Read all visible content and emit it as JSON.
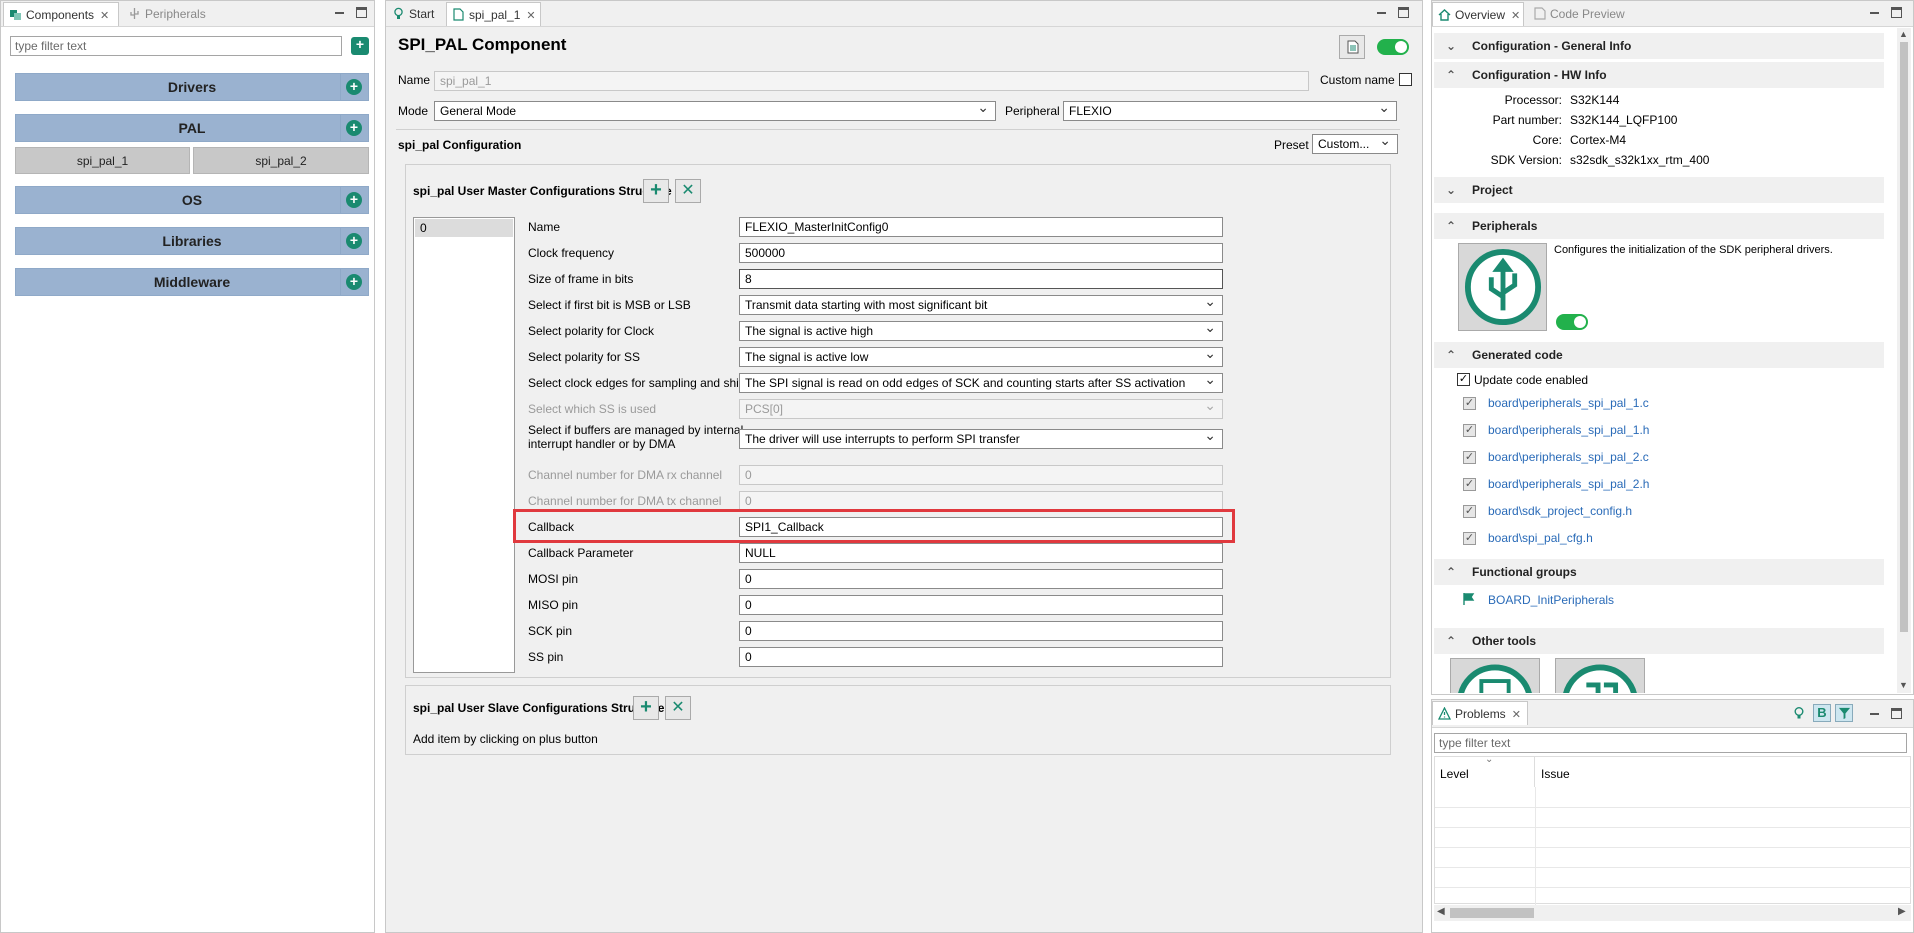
{
  "left_panel": {
    "tabs": [
      {
        "label": "Components"
      },
      {
        "label": "Peripherals"
      }
    ],
    "filter_placeholder": "type filter text",
    "categories": {
      "drivers": "Drivers",
      "pal": "PAL",
      "os": "OS",
      "libraries": "Libraries",
      "middleware": "Middleware"
    },
    "pal_items": [
      "spi_pal_1",
      "spi_pal_2"
    ]
  },
  "center_panel": {
    "tabs": [
      {
        "label": "Start"
      },
      {
        "label": "spi_pal_1"
      }
    ],
    "title": "SPI_PAL Component",
    "name_label": "Name",
    "name_value": "spi_pal_1",
    "custom_name_label": "Custom name",
    "mode_label": "Mode",
    "mode_value": "General Mode",
    "peripheral_label": "Peripheral",
    "peripheral_value": "FLEXIO",
    "config_section": "spi_pal Configuration",
    "preset_label": "Preset",
    "preset_value": "Custom...",
    "master_struct": {
      "title": "spi_pal User Master Configurations Structure",
      "list_items": [
        "0"
      ],
      "rows": [
        {
          "label": "Name",
          "value": "FLEXIO_MasterInitConfig0"
        },
        {
          "label": "Clock frequency",
          "value": "500000"
        },
        {
          "label": "Size of frame in bits",
          "value": "8"
        },
        {
          "label": "Select if first bit is MSB or LSB",
          "value": "Transmit data starting with most significant bit"
        },
        {
          "label": "Select polarity for Clock",
          "value": "The signal is active high"
        },
        {
          "label": "Select polarity for SS",
          "value": "The signal is active low"
        },
        {
          "label": "Select clock edges for sampling and shifting",
          "value": "The SPI signal is read on odd edges of SCK and counting starts after SS activation"
        },
        {
          "label": "Select which SS is used",
          "value": "PCS[0]"
        },
        {
          "label": "Select if buffers are managed by internal",
          "label2": "interrupt handler or by DMA",
          "value": "The driver will use interrupts to perform SPI transfer"
        },
        {
          "label": "Channel number for DMA rx channel",
          "value": "0"
        },
        {
          "label": "Channel number for DMA tx channel",
          "value": "0"
        },
        {
          "label": "Callback",
          "value": "SPI1_Callback"
        },
        {
          "label": "Callback Parameter",
          "value": "NULL"
        },
        {
          "label": "MOSI pin",
          "value": "0"
        },
        {
          "label": "MISO pin",
          "value": "0"
        },
        {
          "label": "SCK pin",
          "value": "0"
        },
        {
          "label": "SS pin",
          "value": "0"
        }
      ]
    },
    "slave_struct": {
      "title": "spi_pal User Slave Configurations Structure",
      "hint": "Add item by clicking on plus button"
    }
  },
  "right_panel": {
    "tabs": [
      {
        "label": "Overview"
      },
      {
        "label": "Code Preview"
      }
    ],
    "sections": {
      "general_info": "Configuration - General Info",
      "hw_info": "Configuration - HW Info",
      "project": "Project",
      "peripherals": "Peripherals",
      "generated_code": "Generated code",
      "functional_groups": "Functional groups",
      "other_tools": "Other tools"
    },
    "hw_info": {
      "processor_label": "Processor:",
      "processor": "S32K144",
      "part_label": "Part number:",
      "part": "S32K144_LQFP100",
      "core_label": "Core:",
      "core": "Cortex-M4",
      "sdk_label": "SDK Version:",
      "sdk": "s32sdk_s32k1xx_rtm_400"
    },
    "peripherals_desc": "Configures the initialization of the SDK peripheral drivers.",
    "update_code_label": "Update code enabled",
    "generated_files": [
      "board\\peripherals_spi_pal_1.c",
      "board\\peripherals_spi_pal_1.h",
      "board\\peripherals_spi_pal_2.c",
      "board\\peripherals_spi_pal_2.h",
      "board\\sdk_project_config.h",
      "board\\spi_pal_cfg.h"
    ],
    "functional_group": "BOARD_InitPeripherals"
  },
  "problems_panel": {
    "tab": "Problems",
    "filter_placeholder": "type filter text",
    "columns": [
      "Level",
      "Issue"
    ]
  },
  "colors": {
    "accent_green": "#1a8a70",
    "category_blue": "#9ab2d0",
    "highlight_red": "#e0393e",
    "link_blue": "#2a6bb8",
    "toggle_green": "#22b14c"
  }
}
